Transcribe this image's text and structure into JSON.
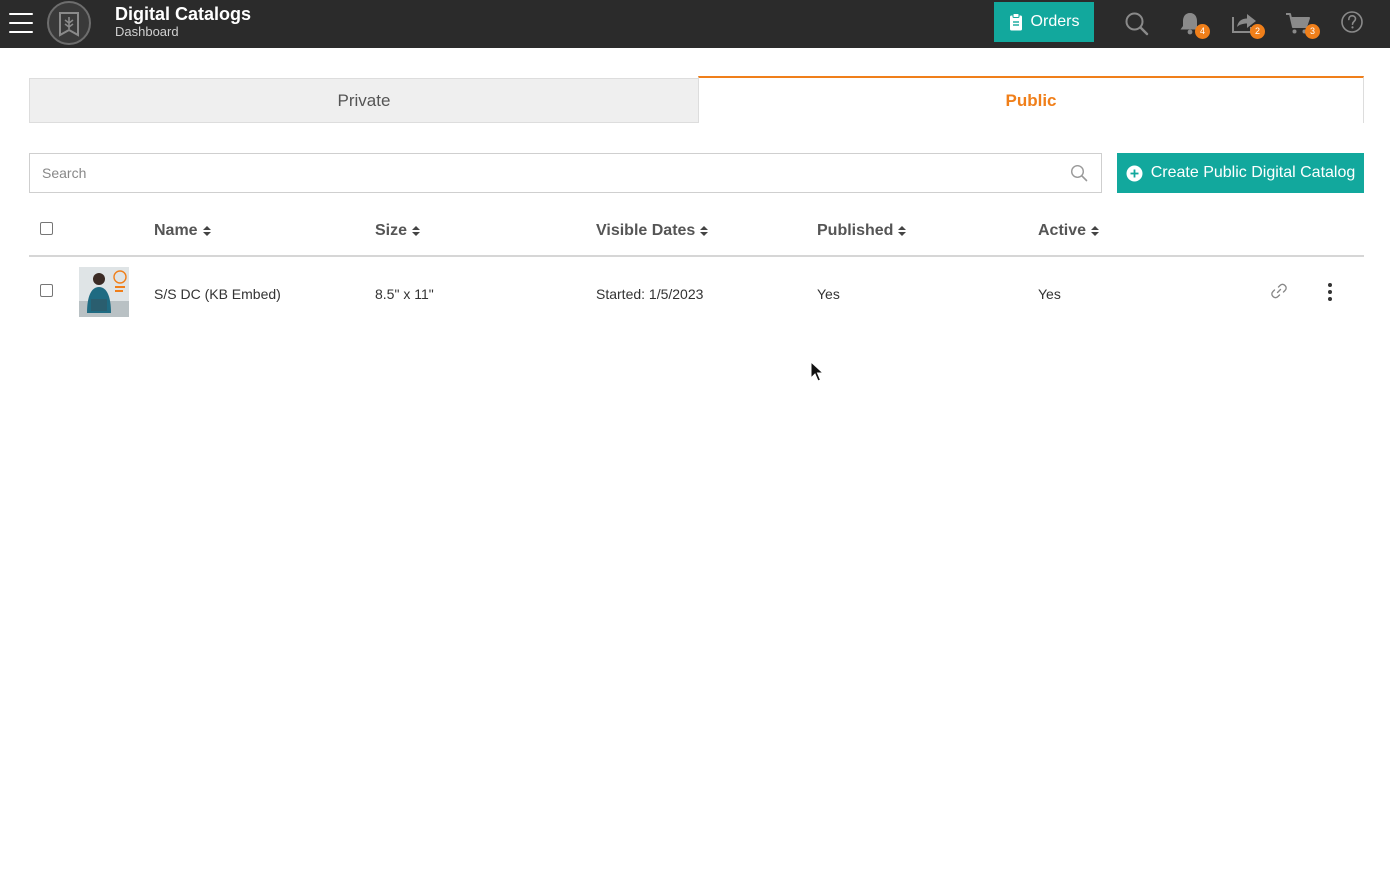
{
  "header": {
    "title": "Digital Catalogs",
    "subtitle": "Dashboard",
    "orders_label": "Orders",
    "badges": {
      "notifications": "4",
      "shares": "2",
      "cart": "3"
    },
    "icons": [
      "menu-icon",
      "logo-icon",
      "clipboard-icon",
      "search-icon",
      "bell-icon",
      "share-icon",
      "cart-icon",
      "help-icon"
    ]
  },
  "tabs": [
    {
      "label": "Private",
      "active": false
    },
    {
      "label": "Public",
      "active": true
    }
  ],
  "search": {
    "placeholder": "Search",
    "value": ""
  },
  "create_button": {
    "label": "Create Public Digital Catalog"
  },
  "table": {
    "columns": [
      "Name",
      "Size",
      "Visible Dates",
      "Published",
      "Active"
    ],
    "rows": [
      {
        "name": "S/S DC (KB Embed)",
        "size": "8.5\" x 11\"",
        "visible_dates": "Started: 1/5/2023",
        "published": "Yes",
        "active": "Yes"
      }
    ]
  },
  "colors": {
    "topbar": "#2b2b2b",
    "accent_teal": "#12a89d",
    "accent_orange": "#f07f1a"
  }
}
